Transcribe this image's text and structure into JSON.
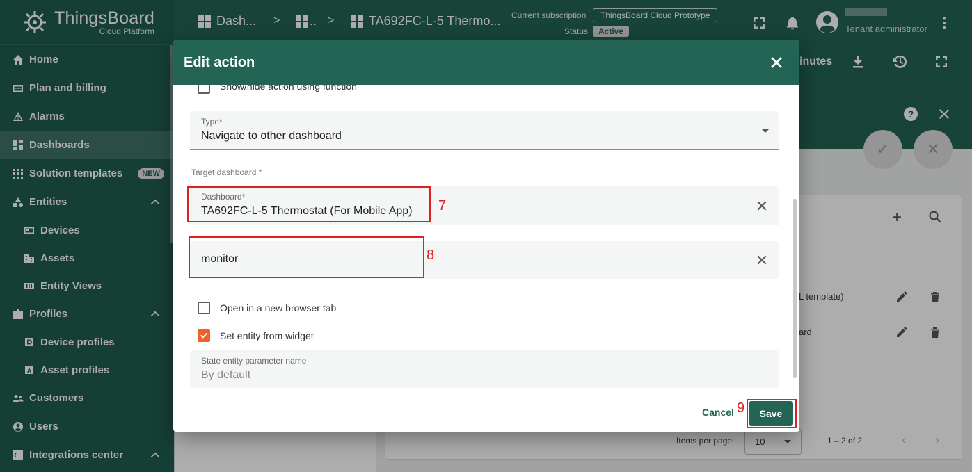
{
  "logo": {
    "title": "ThingsBoard",
    "subtitle": "Cloud Platform"
  },
  "sidebar": {
    "items": [
      {
        "label": "Home",
        "icon": "home-icon"
      },
      {
        "label": "Plan and billing",
        "icon": "billing-icon"
      },
      {
        "label": "Alarms",
        "icon": "alarm-icon"
      },
      {
        "label": "Dashboards",
        "icon": "dashboard-icon",
        "active": true
      },
      {
        "label": "Solution templates",
        "icon": "grid-icon",
        "badge": "NEW"
      },
      {
        "label": "Entities",
        "icon": "entities-icon",
        "expanded": true
      },
      {
        "label": "Devices",
        "icon": "device-icon",
        "sub": true
      },
      {
        "label": "Assets",
        "icon": "asset-icon",
        "sub": true
      },
      {
        "label": "Entity Views",
        "icon": "entity-view-icon",
        "sub": true
      },
      {
        "label": "Profiles",
        "icon": "profiles-icon",
        "expanded": true
      },
      {
        "label": "Device profiles",
        "icon": "device-profile-icon",
        "sub": true
      },
      {
        "label": "Asset profiles",
        "icon": "asset-profile-icon",
        "sub": true
      },
      {
        "label": "Customers",
        "icon": "customers-icon"
      },
      {
        "label": "Users",
        "icon": "users-icon"
      },
      {
        "label": "Integrations center",
        "icon": "integrations-icon",
        "expanded": true
      }
    ]
  },
  "topbar": {
    "breadcrumbs": [
      "Dash...",
      "..",
      "TA692FC-L-5 Thermo..."
    ],
    "separator": ">",
    "subscription_label": "Current subscription",
    "subscription_value": "ThingsBoard Cloud Prototype",
    "status_label": "Status",
    "status_value": "Active",
    "user_role": "Tenant administrator"
  },
  "background": {
    "timewindow_fragment": "inutes",
    "row1_fragment": "L template)",
    "row2_fragment": "ard",
    "items_per_page_label": "Items per page:",
    "items_per_page_value": "10",
    "pagination_range": "1 – 2 of 2"
  },
  "dialog": {
    "title": "Edit action",
    "show_hide_label": "Show/hide action using function",
    "type_label": "Type*",
    "type_value": "Navigate to other dashboard",
    "target_dashboard_label": "Target dashboard *",
    "dashboard_label": "Dashboard*",
    "dashboard_value": "TA692FC-L-5 Thermostat (For Mobile App)",
    "state_value": "monitor",
    "open_new_tab_label": "Open in a new browser tab",
    "open_new_tab_checked": false,
    "set_entity_label": "Set entity from widget",
    "set_entity_checked": true,
    "state_entity_param_label": "State entity parameter name",
    "state_entity_param_placeholder": "By default",
    "cancel_label": "Cancel",
    "save_label": "Save"
  },
  "annotations": {
    "n7": "7",
    "n8": "8",
    "n9": "9"
  },
  "colors": {
    "primary": "#236454",
    "sidebar": "#1f5c4d",
    "checkbox": "#f0622a",
    "highlight": "#e02020"
  }
}
